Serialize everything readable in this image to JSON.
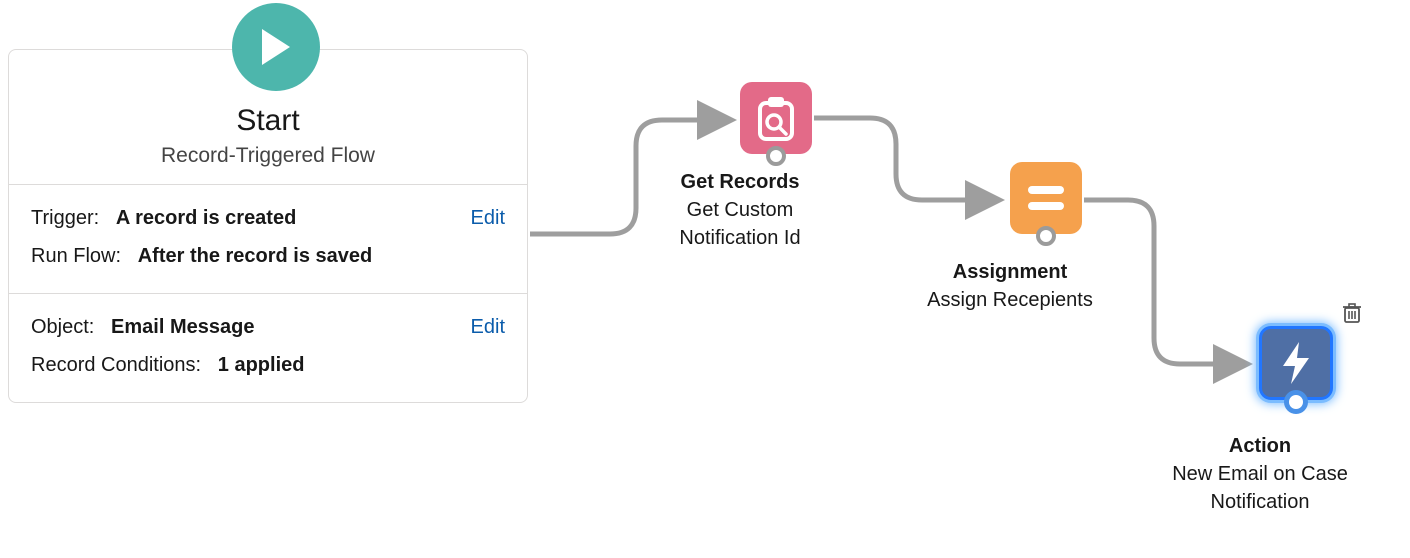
{
  "start": {
    "title": "Start",
    "subtitle": "Record-Triggered Flow",
    "trigger_label": "Trigger:",
    "trigger_value": "A record is created",
    "runflow_label": "Run Flow:",
    "runflow_value": "After the record is saved",
    "object_label": "Object:",
    "object_value": "Email Message",
    "conditions_label": "Record Conditions:",
    "conditions_value": "1 applied",
    "edit_label": "Edit"
  },
  "nodes": {
    "get_records": {
      "title": "Get Records",
      "subtitle": "Get Custom Notification Id"
    },
    "assignment": {
      "title": "Assignment",
      "subtitle": "Assign Recepients"
    },
    "action": {
      "title": "Action",
      "subtitle": "New Email on Case Notification",
      "selected": true
    }
  },
  "colors": {
    "play": "#4db6ac",
    "get_records": "#e36a88",
    "assignment": "#f5a14d",
    "action": "#4f6fa5",
    "link": "#0b5cab",
    "selection_glow": "#7bbcff"
  }
}
